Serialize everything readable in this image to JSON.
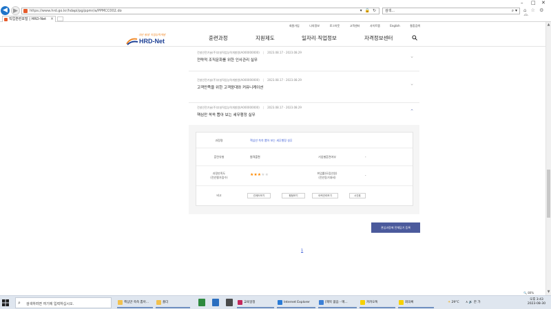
{
  "browser": {
    "url": "https://www.hrd.go.kr/hdapi/pg/ppmr/a/PPMCC002.do",
    "search_placeholder": "검색...",
    "tab_title": "직업훈련포털 | HRD-Net",
    "window_controls": [
      "–",
      "□",
      "✕"
    ],
    "addr_actions": "▾ 🔒 ↻",
    "search_icon_glyph": "⌕ ▾",
    "toolbar_icons": "⌂ ☆ ⚙ ☺"
  },
  "site": {
    "utility_links": [
      "회원가입",
      "나의정보",
      "로그아웃",
      "고객센터",
      "사이트맵",
      "English",
      "통합검색"
    ],
    "logo_tag": "국민 평생 직업능력개발",
    "logo_name": "HRD-Net",
    "gnb": [
      "훈련과정",
      "지원제도",
      "일자리·직업정보",
      "자격정보센터"
    ]
  },
  "list_items": [
    {
      "meta": "건설안전기술(주)부설직업능력개발원(A000000000)",
      "date": "2023.08.17 - 2023.08.29",
      "title": "전략적 조직문화를 위한 인사관리 실무",
      "expanded": false
    },
    {
      "meta": "건설안전기술(주)부설직업능력개발원(A000000000)",
      "date": "2023.08.17 - 2023.08.29",
      "title": "고객만족을 위한 고객응대와 커뮤니케이션",
      "expanded": false
    },
    {
      "meta": "건설안전기술(주)부설직업능력개발원(A000000000)",
      "date": "2023.08.17 - 2023.08.29",
      "title": "핵심만 쏙쏙 뽑아 보는 세무행정 실무",
      "expanded": true
    }
  ],
  "detail": {
    "course_label": "과정명",
    "course_value": "핵심만 쏙쏙 뽑아 보는 세무행정 실무",
    "type_label": "훈련유형",
    "type_value": "원격훈련",
    "nonlabel_label": "기업별훈련여부",
    "nonlabel_value": "-",
    "rating_label": "과정만족도\n(전년평가점수)",
    "rating_stars": 3,
    "rating_max": 5,
    "employ_label": "취업률(모집인원)\n(전년동기대비)",
    "employ_value": "-",
    "note_label": "비고",
    "buttons": [
      "관계도보기",
      "평점보기",
      "이력관리보기",
      "시간표"
    ]
  },
  "apply_button": "관심과정에 전체담기 등록",
  "pagination": "1",
  "zoom": "🔍 80%",
  "taskbar": {
    "search_placeholder": "검색하려면 여기에 입력하십시오.",
    "apps": [
      {
        "label": "핵심만 쏙쏙 뽑아...",
        "color": "#f2c14e"
      },
      {
        "label": "폴더",
        "color": "#f2c14e"
      },
      {
        "label": "교육일정",
        "color": "#c3285c"
      },
      {
        "label": "Internet Explorer",
        "color": "#2a7bd6"
      },
      {
        "label": "[제목 없음 - 메...",
        "color": "#3b7fd6"
      },
      {
        "label": "카카오톡",
        "color": "#f7d000"
      },
      {
        "label": "회의록",
        "color": "#f7d000"
      }
    ],
    "weather": "29°C",
    "tray_text": "∧ 🔊 한 가",
    "time": "오후 3:43",
    "date": "2023-08-30"
  }
}
